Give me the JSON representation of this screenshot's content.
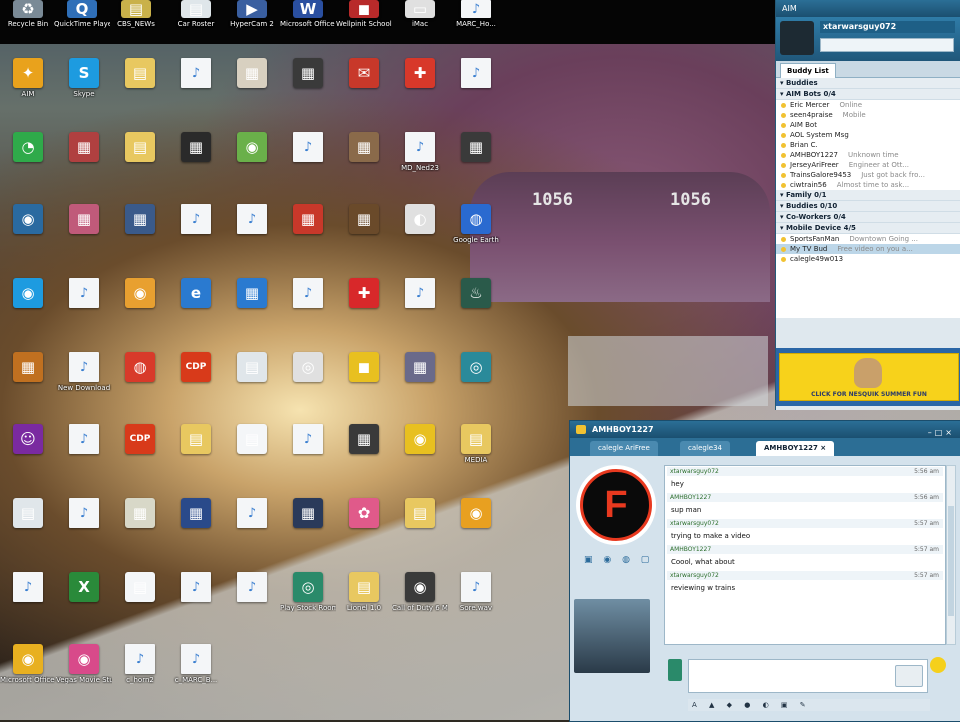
{
  "topbar_icons": [
    {
      "label": "Recycle Bin",
      "glyph": "♻",
      "color": "#7a8a96"
    },
    {
      "label": "QuickTime Player",
      "glyph": "Q",
      "color": "#2f6fb8"
    },
    {
      "label": "CBS_NEWs",
      "glyph": "▤",
      "color": "#c9b14a"
    },
    {
      "label": "Car Roster",
      "glyph": "▤",
      "color": "#dfe6ea"
    },
    {
      "label": "HyperCam 2",
      "glyph": "▶",
      "color": "#3a5fa0"
    },
    {
      "label": "Microsoft Office Wo...",
      "glyph": "W",
      "color": "#2a4fa0"
    },
    {
      "label": "Wellpinit School ...",
      "glyph": "◼",
      "color": "#b82a2a"
    },
    {
      "label": "iMac",
      "glyph": "▭",
      "color": "#e0e0e0"
    },
    {
      "label": "MARC_Ho...",
      "glyph": "♪",
      "color": "#f4f6f8"
    }
  ],
  "desktop_icons": [
    {
      "label": "AIM",
      "glyph": "✦",
      "color": "#e9a21c"
    },
    {
      "label": "Skype",
      "glyph": "S",
      "color": "#1d9be0"
    },
    {
      "label": "",
      "glyph": "▤",
      "color": "#e8c860"
    },
    {
      "label": "",
      "glyph": "♪",
      "color": "#f4f6f8"
    },
    {
      "label": "",
      "glyph": "▦",
      "color": "#d8d0c0"
    },
    {
      "label": "",
      "glyph": "▦",
      "color": "#3a3a3a"
    },
    {
      "label": "",
      "glyph": "✉",
      "color": "#c8382a"
    },
    {
      "label": "",
      "glyph": "✚",
      "color": "#d8382a"
    },
    {
      "label": "",
      "glyph": "♪",
      "color": "#f4f6f8"
    },
    {
      "label": "",
      "glyph": "◔",
      "color": "#2faa4a"
    },
    {
      "label": "",
      "glyph": "▦",
      "color": "#b04040"
    },
    {
      "label": "",
      "glyph": "▤",
      "color": "#e8c860"
    },
    {
      "label": "",
      "glyph": "▦",
      "color": "#2a2a2a"
    },
    {
      "label": "",
      "glyph": "◉",
      "color": "#6ab04a"
    },
    {
      "label": "",
      "glyph": "♪",
      "color": "#f4f6f8"
    },
    {
      "label": "",
      "glyph": "▦",
      "color": "#8a6a4a"
    },
    {
      "label": "MD_Ned23",
      "glyph": "♪",
      "color": "#f4f6f8"
    },
    {
      "label": "",
      "glyph": "▦",
      "color": "#3a3a3a"
    },
    {
      "label": "",
      "glyph": "◉",
      "color": "#2a6aa0"
    },
    {
      "label": "",
      "glyph": "▦",
      "color": "#c05a7a"
    },
    {
      "label": "",
      "glyph": "▦",
      "color": "#3a5a8a"
    },
    {
      "label": "",
      "glyph": "♪",
      "color": "#f4f6f8"
    },
    {
      "label": "",
      "glyph": "♪",
      "color": "#f4f6f8"
    },
    {
      "label": "",
      "glyph": "▦",
      "color": "#c8382a"
    },
    {
      "label": "",
      "glyph": "▦",
      "color": "#6a4a2a"
    },
    {
      "label": "",
      "glyph": "◐",
      "color": "#e0e0e0"
    },
    {
      "label": "Google Earth",
      "glyph": "◍",
      "color": "#2a6ad0"
    },
    {
      "label": "",
      "glyph": "◉",
      "color": "#1d9be0"
    },
    {
      "label": "",
      "glyph": "♪",
      "color": "#f4f6f8"
    },
    {
      "label": "",
      "glyph": "◉",
      "color": "#e8a030"
    },
    {
      "label": "",
      "glyph": "e",
      "color": "#2a7ad0"
    },
    {
      "label": "",
      "glyph": "▦",
      "color": "#2a7ad0"
    },
    {
      "label": "",
      "glyph": "♪",
      "color": "#f4f6f8"
    },
    {
      "label": "",
      "glyph": "✚",
      "color": "#d8282a"
    },
    {
      "label": "",
      "glyph": "♪",
      "color": "#f4f6f8"
    },
    {
      "label": "",
      "glyph": "♨",
      "color": "#2a5a4a"
    },
    {
      "label": "",
      "glyph": "▦",
      "color": "#c07020"
    },
    {
      "label": "New Download",
      "glyph": "♪",
      "color": "#f4f6f8"
    },
    {
      "label": "",
      "glyph": "◍",
      "color": "#d83a2a"
    },
    {
      "label": "",
      "glyph": "CDP",
      "color": "#d83a1a"
    },
    {
      "label": "",
      "glyph": "▤",
      "color": "#e0e6ea"
    },
    {
      "label": "",
      "glyph": "◎",
      "color": "#e0e0e0"
    },
    {
      "label": "",
      "glyph": "◼",
      "color": "#e8c020"
    },
    {
      "label": "",
      "glyph": "▦",
      "color": "#6a6a8a"
    },
    {
      "label": "",
      "glyph": "◎",
      "color": "#2a8a9a"
    },
    {
      "label": "",
      "glyph": "☺",
      "color": "#7a2aa0"
    },
    {
      "label": "",
      "glyph": "♪",
      "color": "#f4f6f8"
    },
    {
      "label": "",
      "glyph": "CDP",
      "color": "#d83a1a"
    },
    {
      "label": "",
      "glyph": "▤",
      "color": "#e8c860"
    },
    {
      "label": "",
      "glyph": "▤",
      "color": "#f4f6f8"
    },
    {
      "label": "",
      "glyph": "♪",
      "color": "#f4f6f8"
    },
    {
      "label": "",
      "glyph": "▦",
      "color": "#3a3a3a"
    },
    {
      "label": "",
      "glyph": "◉",
      "color": "#e8c020"
    },
    {
      "label": "MEDIA",
      "glyph": "▤",
      "color": "#e8c860"
    },
    {
      "label": "",
      "glyph": "▤",
      "color": "#e0e6ea"
    },
    {
      "label": "",
      "glyph": "♪",
      "color": "#f4f6f8"
    },
    {
      "label": "",
      "glyph": "▦",
      "color": "#d8d8c8"
    },
    {
      "label": "",
      "glyph": "▦",
      "color": "#2a4a8a"
    },
    {
      "label": "",
      "glyph": "♪",
      "color": "#f4f6f8"
    },
    {
      "label": "",
      "glyph": "▦",
      "color": "#2a3a5a"
    },
    {
      "label": "",
      "glyph": "✿",
      "color": "#e05a8a"
    },
    {
      "label": "",
      "glyph": "▤",
      "color": "#e8c860"
    },
    {
      "label": "",
      "glyph": "◉",
      "color": "#e8a020"
    },
    {
      "label": "",
      "glyph": "♪",
      "color": "#f4f6f8"
    },
    {
      "label": "",
      "glyph": "X",
      "color": "#2a8a3a"
    },
    {
      "label": "",
      "glyph": "▤",
      "color": "#f4f6f8"
    },
    {
      "label": "",
      "glyph": "♪",
      "color": "#f4f6f8"
    },
    {
      "label": "",
      "glyph": "♪",
      "color": "#f4f6f8"
    },
    {
      "label": "Play Stock Room &...",
      "glyph": "◎",
      "color": "#2a8a6a"
    },
    {
      "label": "Lionel 1.0",
      "glyph": "▤",
      "color": "#e8c860"
    },
    {
      "label": "Call of Duty 6 Mo...",
      "glyph": "◉",
      "color": "#3a3a3a"
    },
    {
      "label": "Sore.wav",
      "glyph": "♪",
      "color": "#f4f6f8"
    },
    {
      "label": "Microsoft Office Outl...",
      "glyph": "◉",
      "color": "#e8b020"
    },
    {
      "label": "Vegas Movie Studio HD ...",
      "glyph": "◉",
      "color": "#d84a8a"
    },
    {
      "label": "c_horn2",
      "glyph": "♪",
      "color": "#f4f6f8"
    },
    {
      "label": "c_MARC_B...",
      "glyph": "♪",
      "color": "#f4f6f8"
    }
  ],
  "train": {
    "number_left": "1056",
    "number_right": "1056"
  },
  "buddy_window": {
    "title": "AIM",
    "screen_name": "xtarwarsguy072",
    "tabs": [
      "Buddy List",
      ""
    ],
    "groups": [
      {
        "name": "Buddies",
        "items": []
      },
      {
        "name": "AIM Bots 0/4",
        "items": [
          {
            "name": "Eric Mercer",
            "status": "Online"
          },
          {
            "name": "seen4praise",
            "status": "Mobile"
          },
          {
            "name": "AIM Bot",
            "status": ""
          },
          {
            "name": "AOL System Msg",
            "status": ""
          },
          {
            "name": "Brian C.",
            "status": ""
          },
          {
            "name": "AMHBOY1227",
            "status": "Unknown time"
          },
          {
            "name": "JerseyAriFreer",
            "status": "Engineer at Ott..."
          },
          {
            "name": "TrainsGalore9453",
            "status": "Just got back fro..."
          },
          {
            "name": "ciwtrain56",
            "status": "Almost time to ask..."
          }
        ]
      },
      {
        "name": "Family 0/1",
        "items": []
      },
      {
        "name": "Buddies 0/10",
        "items": []
      },
      {
        "name": "Co-Workers 0/4",
        "items": []
      },
      {
        "name": "Mobile Device 4/5",
        "items": [
          {
            "name": "SportsFanMan",
            "status": "Downtown Going ..."
          },
          {
            "name": "My TV Bud",
            "status": "Free video on you a..."
          },
          {
            "name": "calegle49w013",
            "status": ""
          }
        ]
      }
    ],
    "ad_text": "CLICK FOR NESQUIK SUMMER FUN"
  },
  "chat_window": {
    "title": "AMHBOY1227",
    "tabs": [
      "calegle AriFree",
      "calegle34",
      "AMHBOY1227 ×"
    ],
    "buddy_icon_letter": "F",
    "tools_glyphs": "▣ ◉ ◍ ▢",
    "format_bar": "A ▲ ◆ ● ◐ ▣ ✎",
    "messages": [
      {
        "sender": "xtarwarsguy072",
        "time": "5:56 am",
        "text": "hey"
      },
      {
        "sender": "AMHBOY1227",
        "time": "5:56 am",
        "text": "sup man"
      },
      {
        "sender": "xtarwarsguy072",
        "time": "5:57 am",
        "text": "trying to make a video"
      },
      {
        "sender": "AMHBOY1227",
        "time": "5:57 am",
        "text": "Coool, what about"
      },
      {
        "sender": "xtarwarsguy072",
        "time": "5:57 am",
        "text": "reviewing w trains"
      }
    ]
  }
}
